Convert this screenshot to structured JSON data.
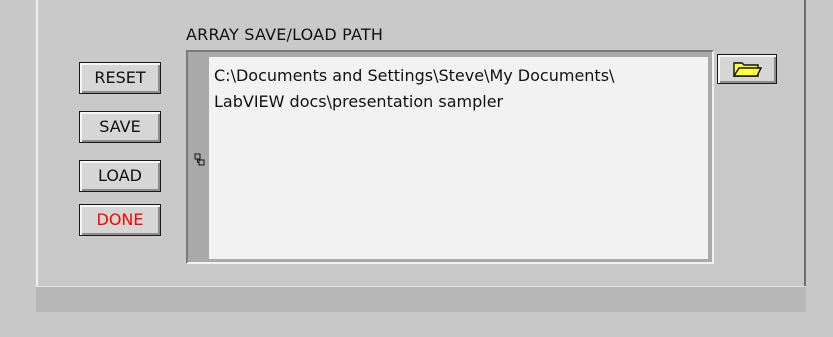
{
  "panel": {
    "path_label": "ARRAY SAVE/LOAD PATH",
    "path_value": "C:\\Documents and Settings\\Steve\\My Documents\\\nLabVIEW docs\\presentation sampler",
    "icons": {
      "browse": "open-folder-icon",
      "path_tree": "tree-connector-icon"
    }
  },
  "buttons": {
    "reset": "RESET",
    "save": "SAVE",
    "load": "LOAD",
    "done": "DONE"
  },
  "colors": {
    "done_text": "#ff0000",
    "folder_fill": "#ffff33"
  }
}
